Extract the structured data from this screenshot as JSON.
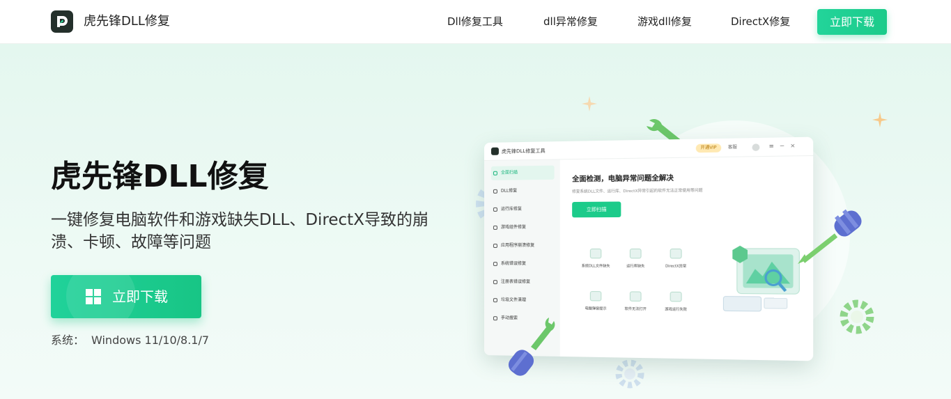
{
  "header": {
    "brand": "虎先锋DLL修复",
    "nav": [
      "Dll修复工具",
      "dll异常修复",
      "游戏dll修复",
      "DirectX修复"
    ],
    "download_button": "立即下载"
  },
  "hero": {
    "title": "虎先锋DLL修复",
    "subtitle": "一键修复电脑软件和游戏缺失DLL、DirectX导致的崩溃、卡顿、故障等问题",
    "download_button": "立即下载",
    "system_label": "系统：",
    "system_value": "Windows 11/10/8.1/7"
  },
  "app_window": {
    "title": "虎先锋DLL修复工具",
    "badge": "开通VIP",
    "service": "客服",
    "controls": [
      "≡",
      "−",
      "×"
    ],
    "sidebar": [
      "全面扫描",
      "DLL修复",
      "运行库修复",
      "游戏组件修复",
      "应用程序崩溃修复",
      "系统错误修复",
      "注册表错误修复",
      "垃圾文件清理",
      "手动搜索"
    ],
    "main_title": "全面检测，电脑异常问题全解决",
    "main_subtitle": "修复系统DLL文件、运行库、DirectX异常引起的软件无法正常使用等问题",
    "scan_button": "立即扫描",
    "features": [
      "系统DLL文件缺失",
      "运行库缺失",
      "DirectX异常",
      "电脑弹窗提示",
      "软件无法打开",
      "游戏运行失败"
    ]
  },
  "colors": {
    "accent": "#1ccb8a",
    "hero_bg": "#e4f7ef",
    "logo_bg": "#24302b"
  },
  "icons": {
    "logo": "brand-logo-icon",
    "windows": "windows-icon"
  }
}
